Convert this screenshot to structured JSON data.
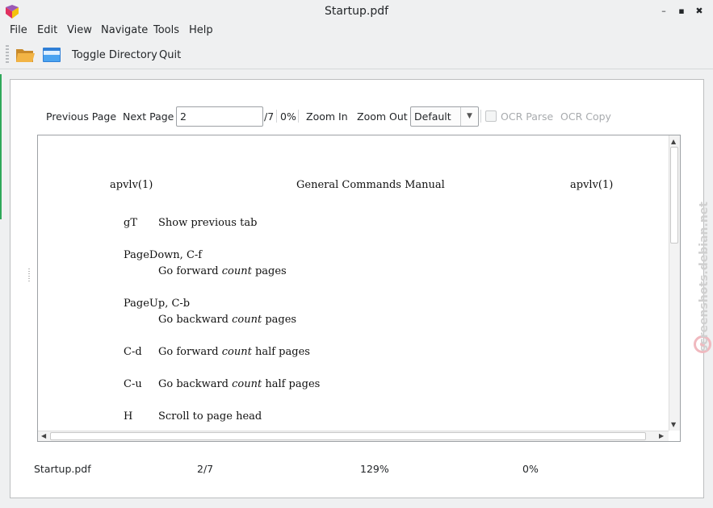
{
  "window": {
    "title": "Startup.pdf"
  },
  "menu": [
    "File",
    "Edit",
    "View",
    "Navigate",
    "Tools",
    "Help"
  ],
  "toolbar": {
    "toggle_directory": "Toggle Directory",
    "quit": "Quit"
  },
  "controls": {
    "previous_page": "Previous Page",
    "next_page": "Next Page",
    "page_value": "2",
    "page_total": "/7",
    "percent": "0%",
    "zoom_in": "Zoom In",
    "zoom_out": "Zoom Out",
    "zoom_mode": "Default",
    "ocr_parse": "OCR Parse",
    "ocr_copy": "OCR Copy"
  },
  "document": {
    "header_left": "apvlv(1)",
    "header_center": "General Commands Manual",
    "header_right": "apvlv(1)",
    "entries": [
      {
        "key": "gT",
        "desc": "Show previous tab"
      },
      {
        "key": "PageDown, C-f",
        "desc_pre": "Go forward ",
        "desc_em": "count",
        "desc_post": " pages"
      },
      {
        "key": "PageUp, C-b",
        "desc_pre": "Go backward ",
        "desc_em": "count",
        "desc_post": " pages"
      },
      {
        "key": "C-d",
        "desc_pre": "Go forward ",
        "desc_em": "count",
        "desc_post": " half pages"
      },
      {
        "key": "C-u",
        "desc_pre": "Go backward ",
        "desc_em": "count",
        "desc_post": " half pages"
      },
      {
        "key": "H",
        "desc": "Scroll to page head"
      }
    ]
  },
  "status": {
    "file": "Startup.pdf",
    "page": "2/7",
    "zoom": "129%",
    "progress": "0%"
  },
  "watermark": "screenshots.debian.net"
}
